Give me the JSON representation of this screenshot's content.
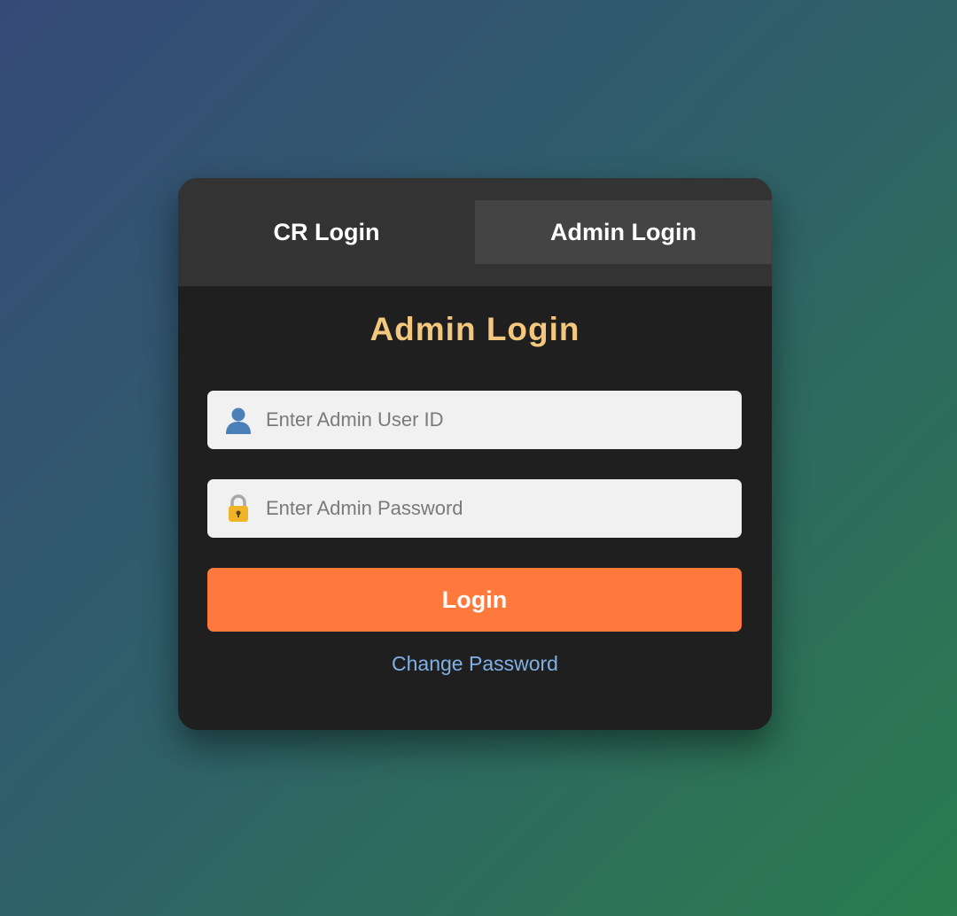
{
  "tabs": {
    "cr_label": "CR Login",
    "admin_label": "Admin Login",
    "active": "admin"
  },
  "form": {
    "heading": "Admin Login",
    "user_id": {
      "value": "",
      "placeholder": "Enter Admin User ID",
      "icon": "user-icon"
    },
    "password": {
      "value": "",
      "placeholder": "Enter Admin Password",
      "icon": "lock-icon"
    },
    "login_label": "Login",
    "change_password_label": "Change Password"
  },
  "colors": {
    "heading": "#f3c77e",
    "login_button": "#ff783c",
    "link": "#7fb0e6",
    "card": "#1f1f1f"
  }
}
